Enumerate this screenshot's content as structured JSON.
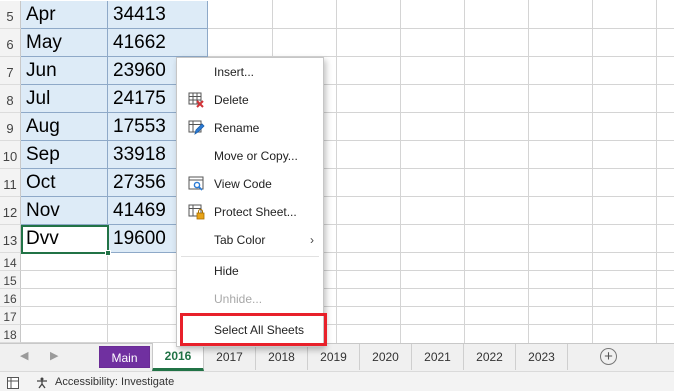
{
  "sheet": {
    "rows": [
      {
        "num": "5",
        "month": "Apr",
        "value": "34413"
      },
      {
        "num": "6",
        "month": "May",
        "value": "41662"
      },
      {
        "num": "7",
        "month": "Jun",
        "value": "23960"
      },
      {
        "num": "8",
        "month": "Jul",
        "value": "24175"
      },
      {
        "num": "9",
        "month": "Aug",
        "value": "17553"
      },
      {
        "num": "10",
        "month": "Sep",
        "value": "33918"
      },
      {
        "num": "11",
        "month": "Oct",
        "value": "27356"
      },
      {
        "num": "12",
        "month": "Nov",
        "value": "41469"
      },
      {
        "num": "13",
        "month": "Dvv",
        "value": "19600"
      }
    ],
    "empty_rows": [
      "14",
      "15",
      "16",
      "17",
      "18"
    ]
  },
  "context_menu": {
    "items": [
      {
        "label": "Insert...",
        "icon": "",
        "enabled": true
      },
      {
        "label": "Delete",
        "icon": "delete-sheet-icon",
        "enabled": true
      },
      {
        "label": "Rename",
        "icon": "rename-sheet-icon",
        "enabled": true
      },
      {
        "label": "Move or Copy...",
        "icon": "",
        "enabled": true
      },
      {
        "label": "View Code",
        "icon": "view-code-icon",
        "enabled": true
      },
      {
        "label": "Protect Sheet...",
        "icon": "protect-sheet-icon",
        "enabled": true
      },
      {
        "label": "Tab Color",
        "icon": "",
        "enabled": true,
        "submenu": true
      },
      {
        "label": "Hide",
        "icon": "",
        "enabled": true
      },
      {
        "label": "Unhide...",
        "icon": "",
        "enabled": false
      },
      {
        "label": "Select All Sheets",
        "icon": "",
        "enabled": true
      }
    ],
    "highlighted_item": "Select All Sheets",
    "highlight_color": "#e8202a"
  },
  "sheet_tabs": {
    "tabs": [
      {
        "label": "Main",
        "color": "#7030a0"
      },
      {
        "label": "2016",
        "active": true
      },
      {
        "label": "2017"
      },
      {
        "label": "2018"
      },
      {
        "label": "2019"
      },
      {
        "label": "2020"
      },
      {
        "label": "2021"
      },
      {
        "label": "2022"
      },
      {
        "label": "2023"
      }
    ],
    "add_sheet_symbol": "+",
    "active_color": "#217346"
  },
  "status_bar": {
    "accessibility_text": "Accessibility: Investigate"
  },
  "glyphs": {
    "nav_prev": "◀",
    "nav_next": "▶",
    "submenu_arrow": "›"
  }
}
